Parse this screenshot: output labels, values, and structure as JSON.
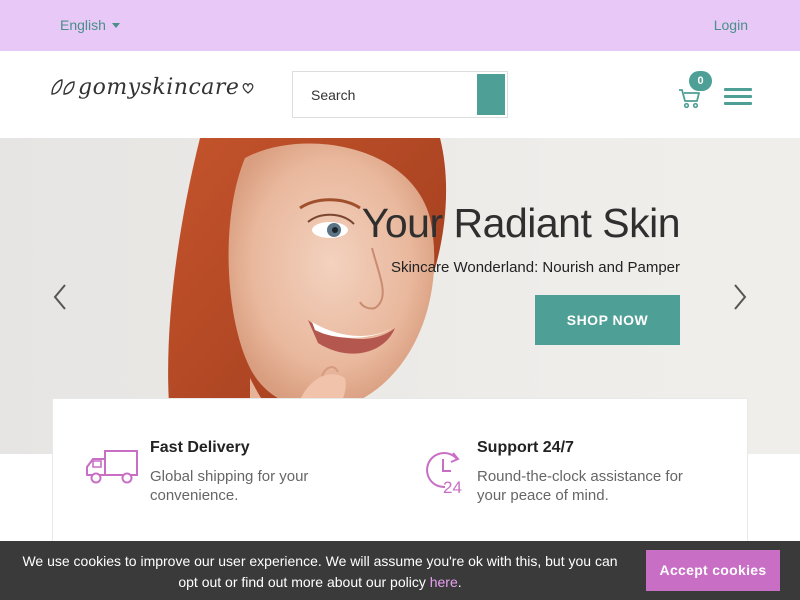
{
  "topbar": {
    "language": "English",
    "login": "Login"
  },
  "header": {
    "logo_text": "gomyskincare",
    "search_placeholder": "Search",
    "cart_count": "0"
  },
  "hero": {
    "title": "Your Radiant Skin",
    "subtitle": "Skincare Wonderland: Nourish and Pamper",
    "cta": "SHOP NOW"
  },
  "features": [
    {
      "title": "Fast Delivery",
      "description": "Global shipping for your convenience.",
      "icon": "truck-icon"
    },
    {
      "title": "Support 24/7",
      "description": "Round-the-clock assistance for your peace of mind.",
      "icon": "clock-24-icon"
    }
  ],
  "cookie": {
    "text": "We use cookies to improve our user experience. We will assume you're ok with this, but you can opt out or find out more about our policy",
    "link": "here",
    "button": "Accept cookies"
  },
  "colors": {
    "topbar_bg": "#e8c8f7",
    "accent_teal": "#4e9f95",
    "accent_pink": "#c86fc5",
    "cookie_bg": "#3a3a3a"
  }
}
